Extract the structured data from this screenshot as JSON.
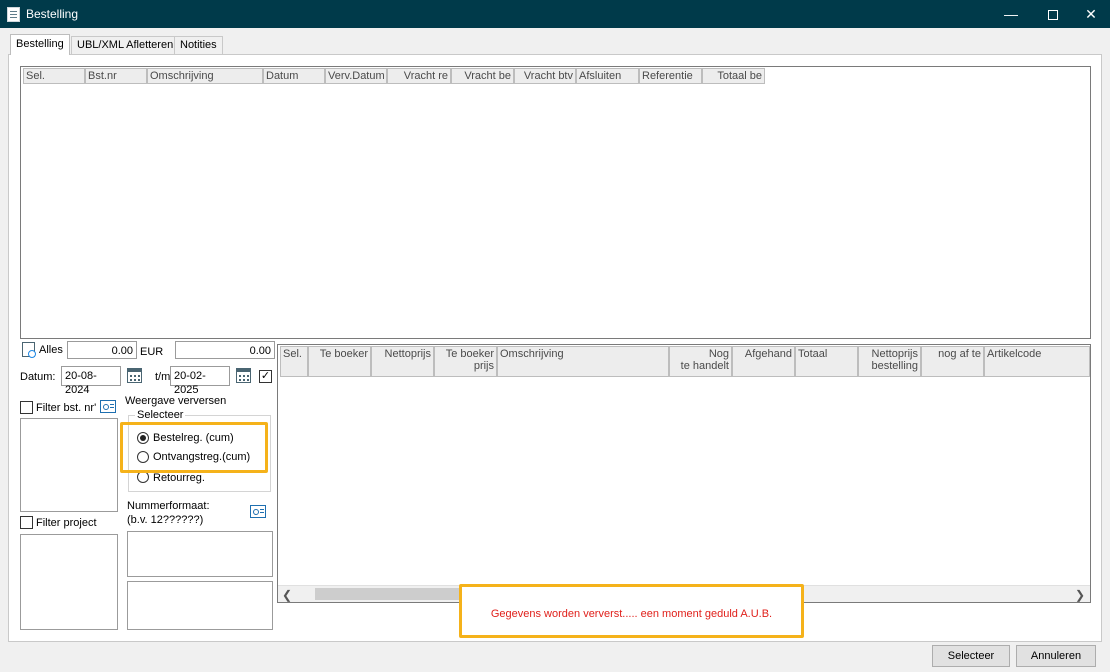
{
  "window": {
    "title": "Bestelling"
  },
  "tabs": [
    {
      "label": "Bestelling",
      "active": true
    },
    {
      "label": "UBL/XML Afletteren",
      "active": false
    },
    {
      "label": "Notities",
      "active": false
    }
  ],
  "top_grid": {
    "columns": [
      "Sel.",
      "Bst.nr",
      "Omschrijving",
      "Datum",
      "Verv.Datum",
      "Vracht re",
      "Vracht be",
      "Vracht btv",
      "Afsluiten",
      "Referentie",
      "Totaal be"
    ]
  },
  "filters": {
    "alles_label": "Alles",
    "amount_value": "0.00",
    "currency_label": "EUR",
    "currency_value": "0.00",
    "datum_label": "Datum:",
    "date_from": "20-08-2024",
    "tm_label": "t/m",
    "date_to": "20-02-2025",
    "date_checked": true,
    "filter_bst_label": "Filter bst. nr'",
    "filter_project_label": "Filter project",
    "weergave_label": "Weergave verversen",
    "selecteer_group_label": "Selecteer",
    "radio_options": [
      {
        "label": "Bestelreg. (cum)",
        "selected": true
      },
      {
        "label": "Ontvangstreg.(cum)",
        "selected": false
      },
      {
        "label": "Retourreg.",
        "selected": false
      }
    ],
    "nummerformaat_label": "Nummerformaat:",
    "nummerformaat_hint": "(b.v. 12??????)"
  },
  "bottom_grid": {
    "columns": [
      [
        "Sel.",
        ""
      ],
      [
        "Te boeker",
        ""
      ],
      [
        "Nettoprijs",
        ""
      ],
      [
        "Te boeker",
        "prijs"
      ],
      [
        "Omschrijving",
        ""
      ],
      [
        "Nog",
        "te handelt"
      ],
      [
        "Afgehand",
        ""
      ],
      [
        "Totaal",
        ""
      ],
      [
        "Nettoprijs",
        "bestelling"
      ],
      [
        "",
        "nog af te"
      ],
      [
        "Artikelcode",
        ""
      ]
    ],
    "scroll_position": 0.04
  },
  "status": {
    "message": "Gegevens worden ververst..... een moment geduld A.U.B.",
    "color": "#e0201b"
  },
  "buttons": {
    "select": "Selecteer",
    "cancel": "Annuleren"
  },
  "icons": {
    "accent": "#f5b21a",
    "titlebar_bg": "#003a4a"
  }
}
